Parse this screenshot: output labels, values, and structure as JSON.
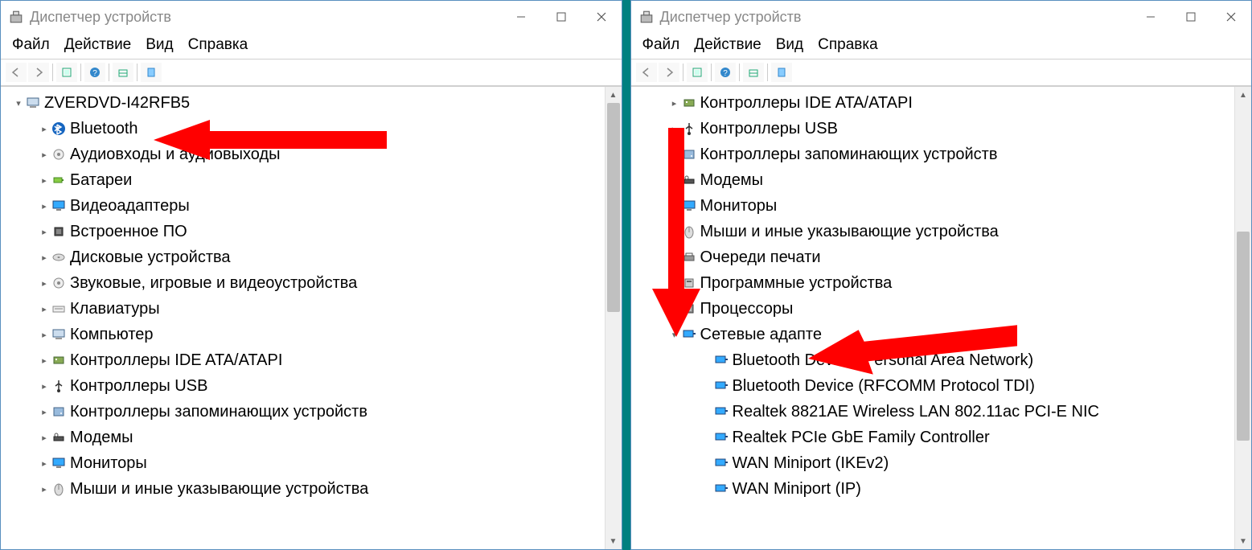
{
  "window_title": "Диспетчер устройств",
  "menubar": {
    "file": "Файл",
    "action": "Действие",
    "view": "Вид",
    "help": "Справка"
  },
  "left_window": {
    "root": "ZVERDVD-I42RFB5",
    "items": [
      {
        "label": "Bluetooth",
        "icon": "bluetooth",
        "highlight": true
      },
      {
        "label": "Аудиовходы и аудиовыходы",
        "icon": "audio"
      },
      {
        "label": "Батареи",
        "icon": "battery"
      },
      {
        "label": "Видеоадаптеры",
        "icon": "display"
      },
      {
        "label": "Встроенное ПО",
        "icon": "chip"
      },
      {
        "label": "Дисковые устройства",
        "icon": "disk"
      },
      {
        "label": "Звуковые, игровые и видеоустройства",
        "icon": "audio"
      },
      {
        "label": "Клавиатуры",
        "icon": "keyboard"
      },
      {
        "label": "Компьютер",
        "icon": "computer"
      },
      {
        "label": "Контроллеры IDE ATA/ATAPI",
        "icon": "controller"
      },
      {
        "label": "Контроллеры USB",
        "icon": "usb"
      },
      {
        "label": "Контроллеры запоминающих устройств",
        "icon": "storage"
      },
      {
        "label": "Модемы",
        "icon": "modem"
      },
      {
        "label": "Мониторы",
        "icon": "monitor"
      },
      {
        "label": "Мыши и иные указывающие устройства",
        "icon": "mouse"
      }
    ]
  },
  "right_window": {
    "items": [
      {
        "label": "Контроллеры IDE ATA/ATAPI",
        "icon": "controller",
        "depth": 1,
        "chev": ">"
      },
      {
        "label": "Контроллеры USB",
        "icon": "usb",
        "depth": 1,
        "chev": ">"
      },
      {
        "label": "Контроллеры запоминающих устройств",
        "icon": "storage",
        "depth": 1,
        "chev": ">"
      },
      {
        "label": "Модемы",
        "icon": "modem",
        "depth": 1,
        "chev": ">"
      },
      {
        "label": "Мониторы",
        "icon": "monitor",
        "depth": 1,
        "chev": ">"
      },
      {
        "label": "Мыши и иные указывающие устройства",
        "icon": "mouse",
        "depth": 1,
        "chev": ">"
      },
      {
        "label": "Очереди печати",
        "icon": "printer",
        "depth": 1,
        "chev": ">"
      },
      {
        "label": "Программные устройства",
        "icon": "software",
        "depth": 1,
        "chev": ">"
      },
      {
        "label": "Процессоры",
        "icon": "cpu",
        "depth": 1,
        "chev": ">"
      },
      {
        "label": "Сетевые адапте",
        "icon": "network",
        "depth": 1,
        "chev": "v",
        "expanded": true
      },
      {
        "label": "Bluetooth Device (Personal Area Network)",
        "icon": "network",
        "depth": 2
      },
      {
        "label": "Bluetooth Device (RFCOMM Protocol TDI)",
        "icon": "network",
        "depth": 2
      },
      {
        "label": "Realtek 8821AE Wireless LAN 802.11ac PCI-E NIC",
        "icon": "network",
        "depth": 2
      },
      {
        "label": "Realtek PCIe GbE Family Controller",
        "icon": "network",
        "depth": 2
      },
      {
        "label": "WAN Miniport (IKEv2)",
        "icon": "network",
        "depth": 2
      },
      {
        "label": "WAN Miniport (IP)",
        "icon": "network",
        "depth": 2
      }
    ]
  }
}
